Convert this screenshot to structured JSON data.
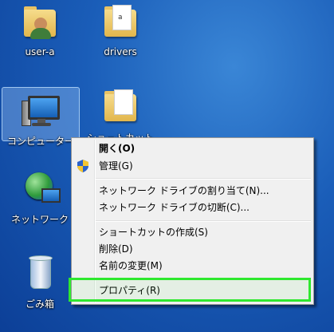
{
  "desktop": {
    "icons": [
      {
        "label": "user-a"
      },
      {
        "label": "drivers"
      },
      {
        "label": "コンピューター"
      },
      {
        "label": "ショートカット"
      },
      {
        "label": "ネットワーク"
      },
      {
        "label": "ごみ箱"
      }
    ]
  },
  "context_menu": {
    "items": [
      {
        "label": "開く(O)"
      },
      {
        "label": "管理(G)"
      },
      {
        "label": "ネットワーク ドライブの割り当て(N)..."
      },
      {
        "label": "ネットワーク ドライブの切断(C)..."
      },
      {
        "label": "ショートカットの作成(S)"
      },
      {
        "label": "削除(D)"
      },
      {
        "label": "名前の変更(M)"
      },
      {
        "label": "プロパティ(R)"
      }
    ]
  },
  "colors": {
    "highlight_border": "#2fe82f",
    "desktop_blue": "#1a5db8"
  },
  "drivers_file_glyph": "a"
}
